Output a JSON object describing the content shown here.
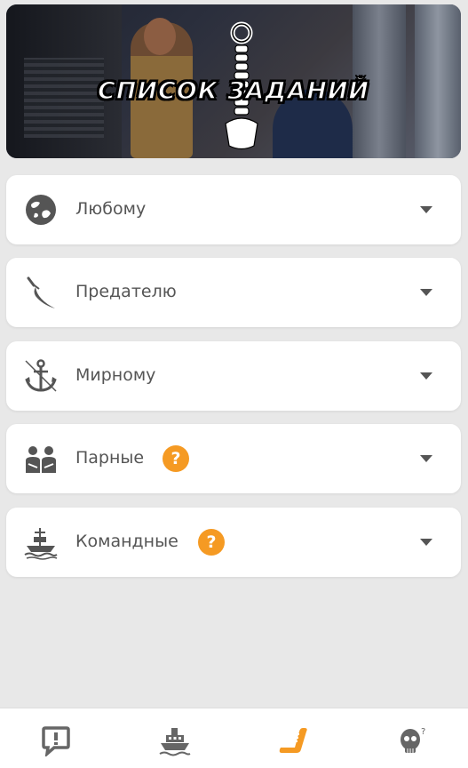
{
  "banner": {
    "title": "СПИСОК ЗАДАНИЙ"
  },
  "sections": [
    {
      "label": "Любому",
      "icon": "globe-icon",
      "has_help": false
    },
    {
      "label": "Предателю",
      "icon": "dagger-icon",
      "has_help": false
    },
    {
      "label": "Мирному",
      "icon": "anchor-icon",
      "has_help": false
    },
    {
      "label": "Парные",
      "icon": "pair-icon",
      "has_help": true,
      "help": "?"
    },
    {
      "label": "Командные",
      "icon": "ship-icon",
      "has_help": true,
      "help": "?"
    }
  ],
  "tabbar": {
    "tabs": [
      {
        "icon": "chat-icon",
        "active": false
      },
      {
        "icon": "steamship-icon",
        "active": false
      },
      {
        "icon": "scroll-icon",
        "active": true
      },
      {
        "icon": "skull-question-icon",
        "active": false
      }
    ]
  },
  "colors": {
    "background": "#e8e8e8",
    "card": "#ffffff",
    "accent": "#f59a23",
    "icon": "#555555"
  }
}
